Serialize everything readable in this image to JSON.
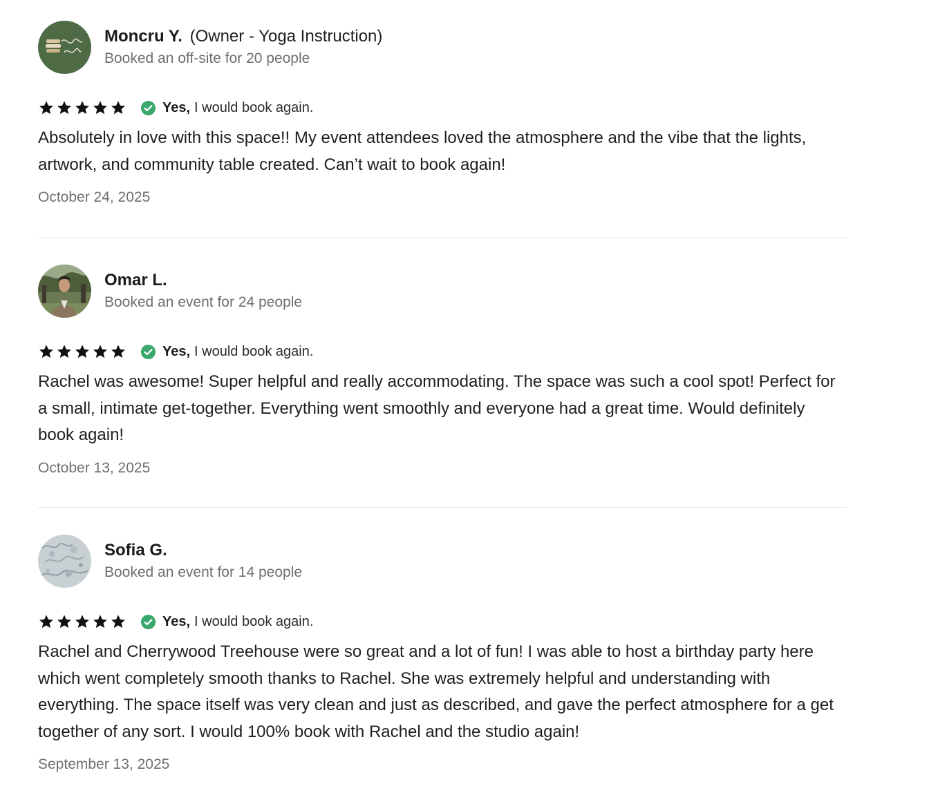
{
  "reviews": [
    {
      "name": "Moncru Y.",
      "role": "(Owner - Yoga Instruction)",
      "booked": "Booked an off-site for 20 people",
      "rating": 5,
      "rebook_yes": "Yes,",
      "rebook_text": "I would book again.",
      "text": "Absolutely in love with this space!! My event attendees loved the atmosphere and the vibe that the lights, artwork, and community table created. Can’t wait to book again!",
      "date": "October 24, 2025"
    },
    {
      "name": "Omar L.",
      "role": "",
      "booked": "Booked an event for 24 people",
      "rating": 5,
      "rebook_yes": "Yes,",
      "rebook_text": "I would book again.",
      "text": "Rachel was awesome! Super helpful and really accommodating. The space was such a cool spot! Perfect for a small, intimate get-together. Everything went smoothly and everyone had a great time. Would definitely book again!",
      "date": "October 13, 2025"
    },
    {
      "name": "Sofia G.",
      "role": "",
      "booked": "Booked an event for 14 people",
      "rating": 5,
      "rebook_yes": "Yes,",
      "rebook_text": "I would book again.",
      "text": "Rachel and Cherrywood Treehouse were so great and a lot of fun! I was able to host a birthday party here which went completely smooth thanks to Rachel. She was extremely helpful and understanding with everything. The space itself was very clean and just as described, and gave the perfect atmosphere for a get together of any sort. I would 100% book with Rachel and the studio again!",
      "date": "September 13, 2025"
    }
  ],
  "colors": {
    "check_green": "#3aa76d",
    "star": "#111111",
    "muted_text": "#6e6e73",
    "divider": "#e6e6e6",
    "avatar1_bg": "#4f6b45"
  },
  "icons": {
    "star": "star-icon",
    "check": "check-circle-icon"
  }
}
